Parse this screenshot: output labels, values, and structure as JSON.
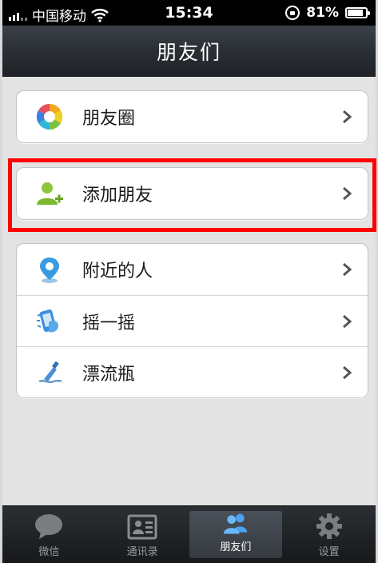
{
  "status_bar": {
    "carrier": "中国移动",
    "time": "15:34",
    "battery": "81%"
  },
  "nav": {
    "title": "朋友们"
  },
  "groups": [
    {
      "items": [
        {
          "label": "朋友圈",
          "icon": "moments-icon"
        }
      ]
    },
    {
      "items": [
        {
          "label": "添加朋友",
          "icon": "add-friend-icon"
        }
      ]
    },
    {
      "items": [
        {
          "label": "附近的人",
          "icon": "location-pin-icon"
        },
        {
          "label": "摇一摇",
          "icon": "shake-phone-icon"
        },
        {
          "label": "漂流瓶",
          "icon": "bottle-icon"
        }
      ]
    }
  ],
  "tabs": [
    {
      "label": "微信",
      "icon": "chat-bubble-icon",
      "active": false
    },
    {
      "label": "通讯录",
      "icon": "contacts-card-icon",
      "active": false
    },
    {
      "label": "朋友们",
      "icon": "friends-icon",
      "active": true
    },
    {
      "label": "设置",
      "icon": "gear-icon",
      "active": false
    }
  ],
  "colors": {
    "highlight": "#ff0000",
    "nav_bg": "#2a2f35",
    "content_bg": "#e3e3e3"
  }
}
